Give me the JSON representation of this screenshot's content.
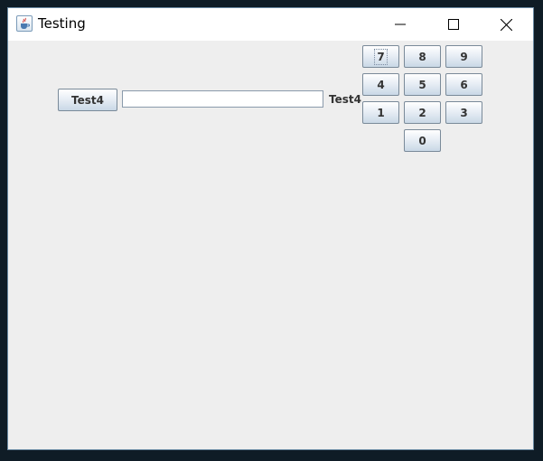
{
  "window": {
    "title": "Testing",
    "icon": "java-cup-icon",
    "controls": [
      "minimize-icon",
      "maximize-icon",
      "close-icon"
    ]
  },
  "form": {
    "button_label": "Test4",
    "text_field_value": "",
    "label_text": "Test4"
  },
  "keypad": {
    "keys": [
      "7",
      "8",
      "9",
      "4",
      "5",
      "6",
      "1",
      "2",
      "3",
      "0"
    ],
    "focused_key": "7"
  },
  "colors": {
    "background": "#eeeeee",
    "button_gradient_top": "#ffffff",
    "button_gradient_bottom": "#c9d8e6",
    "button_border": "#7a8a99",
    "text": "#333333"
  }
}
